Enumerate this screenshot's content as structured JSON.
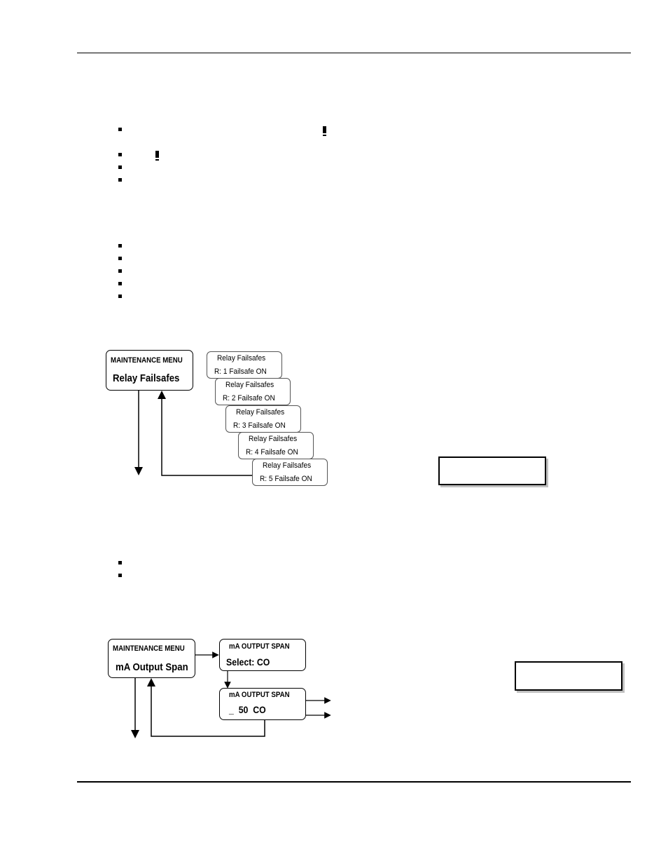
{
  "page": {
    "header_rule": true,
    "footer_rule": true
  },
  "section1": {
    "bullets": [
      "",
      "",
      "",
      ""
    ],
    "inline_glyphs": [
      "key-symbol",
      "key-symbol"
    ]
  },
  "section2": {
    "bullets": [
      "",
      "",
      "",
      "",
      ""
    ]
  },
  "diagram_relay": {
    "main_menu": {
      "line1": "MAINTENANCE  MENU",
      "line2": "Relay Failsafes"
    },
    "screens": [
      {
        "line1": "Relay Failsafes",
        "line2": "R: 1 Failsafe ON"
      },
      {
        "line1": "Relay Failsafes",
        "line2": "R: 2 Failsafe ON"
      },
      {
        "line1": "Relay Failsafes",
        "line2": "R: 3 Failsafe ON"
      },
      {
        "line1": "Relay Failsafes",
        "line2": "R: 4 Failsafe ON"
      },
      {
        "line1": "Relay Failsafes",
        "line2": "R: 5 Failsafe ON"
      }
    ],
    "note_box_text": ""
  },
  "section3": {
    "bullets": [
      "",
      ""
    ]
  },
  "diagram_ma": {
    "main_menu": {
      "line1": "MAINTENANCE  MENU",
      "line2": "mA Output Span"
    },
    "select_screen": {
      "line1": "mA OUTPUT SPAN",
      "line2": "Select: CO"
    },
    "value_screen": {
      "line1": "mA OUTPUT SPAN",
      "line2": "_  50  CO"
    },
    "note_box_text": ""
  }
}
